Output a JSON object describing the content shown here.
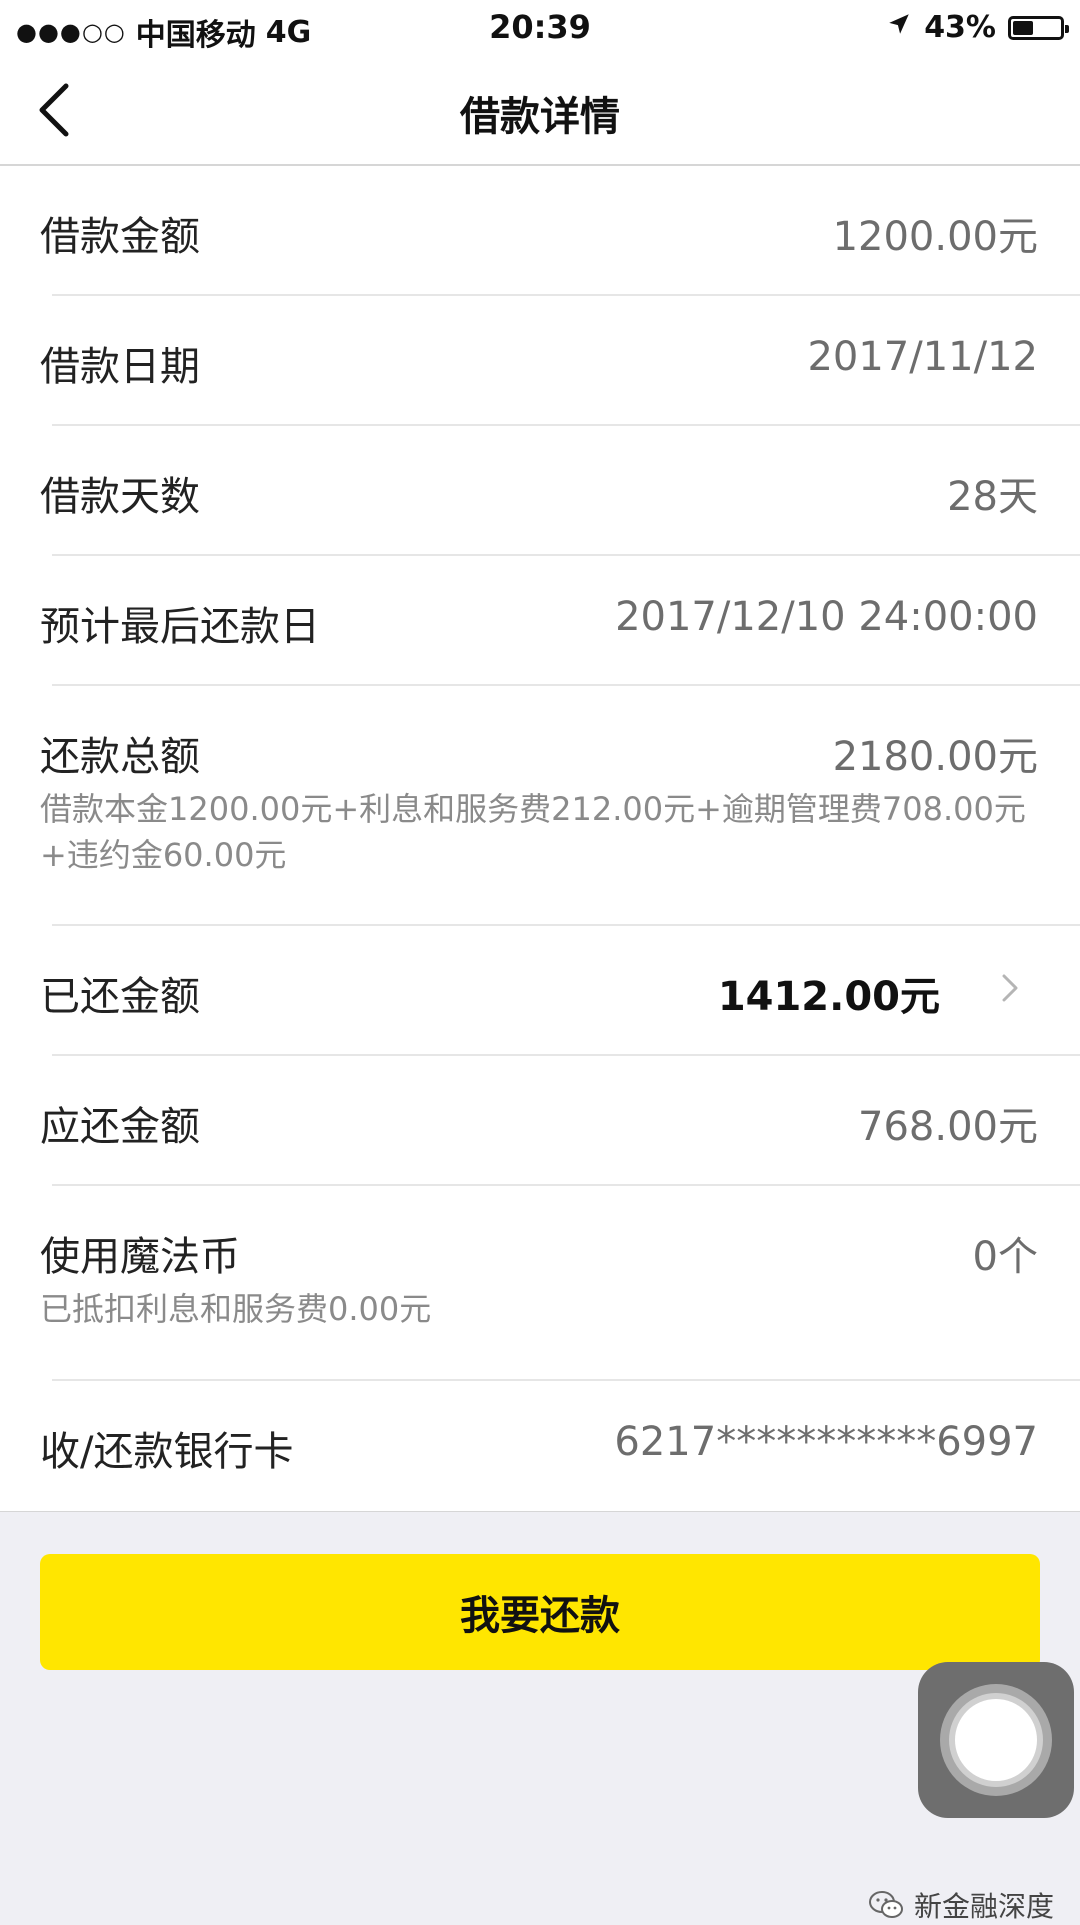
{
  "status_bar": {
    "signal": "●●●○○",
    "carrier": "中国移动",
    "network": "4G",
    "time": "20:39",
    "location_icon": "location-arrow-icon",
    "battery": "43%",
    "battery_level": 0.43
  },
  "nav": {
    "title": "借款详情",
    "back_icon": "chevron-left-icon"
  },
  "details": {
    "loan_amount": {
      "label": "借款金额",
      "value": "1200.00元"
    },
    "loan_date": {
      "label": "借款日期",
      "value": "2017/11/12"
    },
    "loan_days": {
      "label": "借款天数",
      "value": "28天"
    },
    "due_date": {
      "label": "预计最后还款日",
      "value": "2017/12/10 24:00:00"
    },
    "total_repay": {
      "label": "还款总额",
      "value": "2180.00元",
      "breakdown": "借款本金1200.00元+利息和服务费212.00元+逾期管理费708.00元+违约金60.00元"
    },
    "repaid": {
      "label": "已还金额",
      "value": "1412.00元",
      "chevron_icon": "chevron-right-icon"
    },
    "due_amount": {
      "label": "应还金额",
      "value": "768.00元"
    },
    "magic_coin": {
      "label": "使用魔法币",
      "value": "0个",
      "note": "已抵扣利息和服务费0.00元"
    },
    "bank_card": {
      "label": "收/还款银行卡",
      "value": "6217***********6997"
    }
  },
  "repay_button": {
    "label": "我要还款",
    "color": "#ffe600"
  },
  "watermark": {
    "text": "新金融深度",
    "icon": "wechat-icon"
  },
  "assistive_touch": {
    "icon": "assistive-touch-icon"
  }
}
